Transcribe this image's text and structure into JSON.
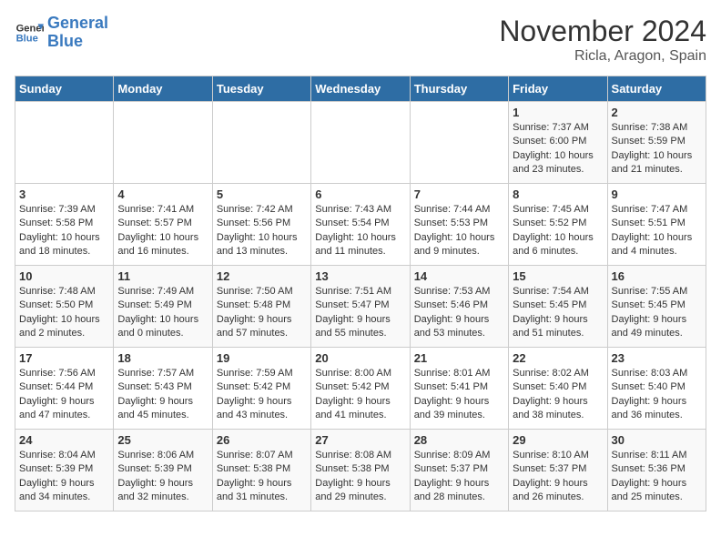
{
  "logo": {
    "line1": "General",
    "line2": "Blue"
  },
  "title": "November 2024",
  "location": "Ricla, Aragon, Spain",
  "days_of_week": [
    "Sunday",
    "Monday",
    "Tuesday",
    "Wednesday",
    "Thursday",
    "Friday",
    "Saturday"
  ],
  "weeks": [
    [
      {
        "day": "",
        "info": ""
      },
      {
        "day": "",
        "info": ""
      },
      {
        "day": "",
        "info": ""
      },
      {
        "day": "",
        "info": ""
      },
      {
        "day": "",
        "info": ""
      },
      {
        "day": "1",
        "info": "Sunrise: 7:37 AM\nSunset: 6:00 PM\nDaylight: 10 hours and 23 minutes."
      },
      {
        "day": "2",
        "info": "Sunrise: 7:38 AM\nSunset: 5:59 PM\nDaylight: 10 hours and 21 minutes."
      }
    ],
    [
      {
        "day": "3",
        "info": "Sunrise: 7:39 AM\nSunset: 5:58 PM\nDaylight: 10 hours and 18 minutes."
      },
      {
        "day": "4",
        "info": "Sunrise: 7:41 AM\nSunset: 5:57 PM\nDaylight: 10 hours and 16 minutes."
      },
      {
        "day": "5",
        "info": "Sunrise: 7:42 AM\nSunset: 5:56 PM\nDaylight: 10 hours and 13 minutes."
      },
      {
        "day": "6",
        "info": "Sunrise: 7:43 AM\nSunset: 5:54 PM\nDaylight: 10 hours and 11 minutes."
      },
      {
        "day": "7",
        "info": "Sunrise: 7:44 AM\nSunset: 5:53 PM\nDaylight: 10 hours and 9 minutes."
      },
      {
        "day": "8",
        "info": "Sunrise: 7:45 AM\nSunset: 5:52 PM\nDaylight: 10 hours and 6 minutes."
      },
      {
        "day": "9",
        "info": "Sunrise: 7:47 AM\nSunset: 5:51 PM\nDaylight: 10 hours and 4 minutes."
      }
    ],
    [
      {
        "day": "10",
        "info": "Sunrise: 7:48 AM\nSunset: 5:50 PM\nDaylight: 10 hours and 2 minutes."
      },
      {
        "day": "11",
        "info": "Sunrise: 7:49 AM\nSunset: 5:49 PM\nDaylight: 10 hours and 0 minutes."
      },
      {
        "day": "12",
        "info": "Sunrise: 7:50 AM\nSunset: 5:48 PM\nDaylight: 9 hours and 57 minutes."
      },
      {
        "day": "13",
        "info": "Sunrise: 7:51 AM\nSunset: 5:47 PM\nDaylight: 9 hours and 55 minutes."
      },
      {
        "day": "14",
        "info": "Sunrise: 7:53 AM\nSunset: 5:46 PM\nDaylight: 9 hours and 53 minutes."
      },
      {
        "day": "15",
        "info": "Sunrise: 7:54 AM\nSunset: 5:45 PM\nDaylight: 9 hours and 51 minutes."
      },
      {
        "day": "16",
        "info": "Sunrise: 7:55 AM\nSunset: 5:45 PM\nDaylight: 9 hours and 49 minutes."
      }
    ],
    [
      {
        "day": "17",
        "info": "Sunrise: 7:56 AM\nSunset: 5:44 PM\nDaylight: 9 hours and 47 minutes."
      },
      {
        "day": "18",
        "info": "Sunrise: 7:57 AM\nSunset: 5:43 PM\nDaylight: 9 hours and 45 minutes."
      },
      {
        "day": "19",
        "info": "Sunrise: 7:59 AM\nSunset: 5:42 PM\nDaylight: 9 hours and 43 minutes."
      },
      {
        "day": "20",
        "info": "Sunrise: 8:00 AM\nSunset: 5:42 PM\nDaylight: 9 hours and 41 minutes."
      },
      {
        "day": "21",
        "info": "Sunrise: 8:01 AM\nSunset: 5:41 PM\nDaylight: 9 hours and 39 minutes."
      },
      {
        "day": "22",
        "info": "Sunrise: 8:02 AM\nSunset: 5:40 PM\nDaylight: 9 hours and 38 minutes."
      },
      {
        "day": "23",
        "info": "Sunrise: 8:03 AM\nSunset: 5:40 PM\nDaylight: 9 hours and 36 minutes."
      }
    ],
    [
      {
        "day": "24",
        "info": "Sunrise: 8:04 AM\nSunset: 5:39 PM\nDaylight: 9 hours and 34 minutes."
      },
      {
        "day": "25",
        "info": "Sunrise: 8:06 AM\nSunset: 5:39 PM\nDaylight: 9 hours and 32 minutes."
      },
      {
        "day": "26",
        "info": "Sunrise: 8:07 AM\nSunset: 5:38 PM\nDaylight: 9 hours and 31 minutes."
      },
      {
        "day": "27",
        "info": "Sunrise: 8:08 AM\nSunset: 5:38 PM\nDaylight: 9 hours and 29 minutes."
      },
      {
        "day": "28",
        "info": "Sunrise: 8:09 AM\nSunset: 5:37 PM\nDaylight: 9 hours and 28 minutes."
      },
      {
        "day": "29",
        "info": "Sunrise: 8:10 AM\nSunset: 5:37 PM\nDaylight: 9 hours and 26 minutes."
      },
      {
        "day": "30",
        "info": "Sunrise: 8:11 AM\nSunset: 5:36 PM\nDaylight: 9 hours and 25 minutes."
      }
    ]
  ]
}
